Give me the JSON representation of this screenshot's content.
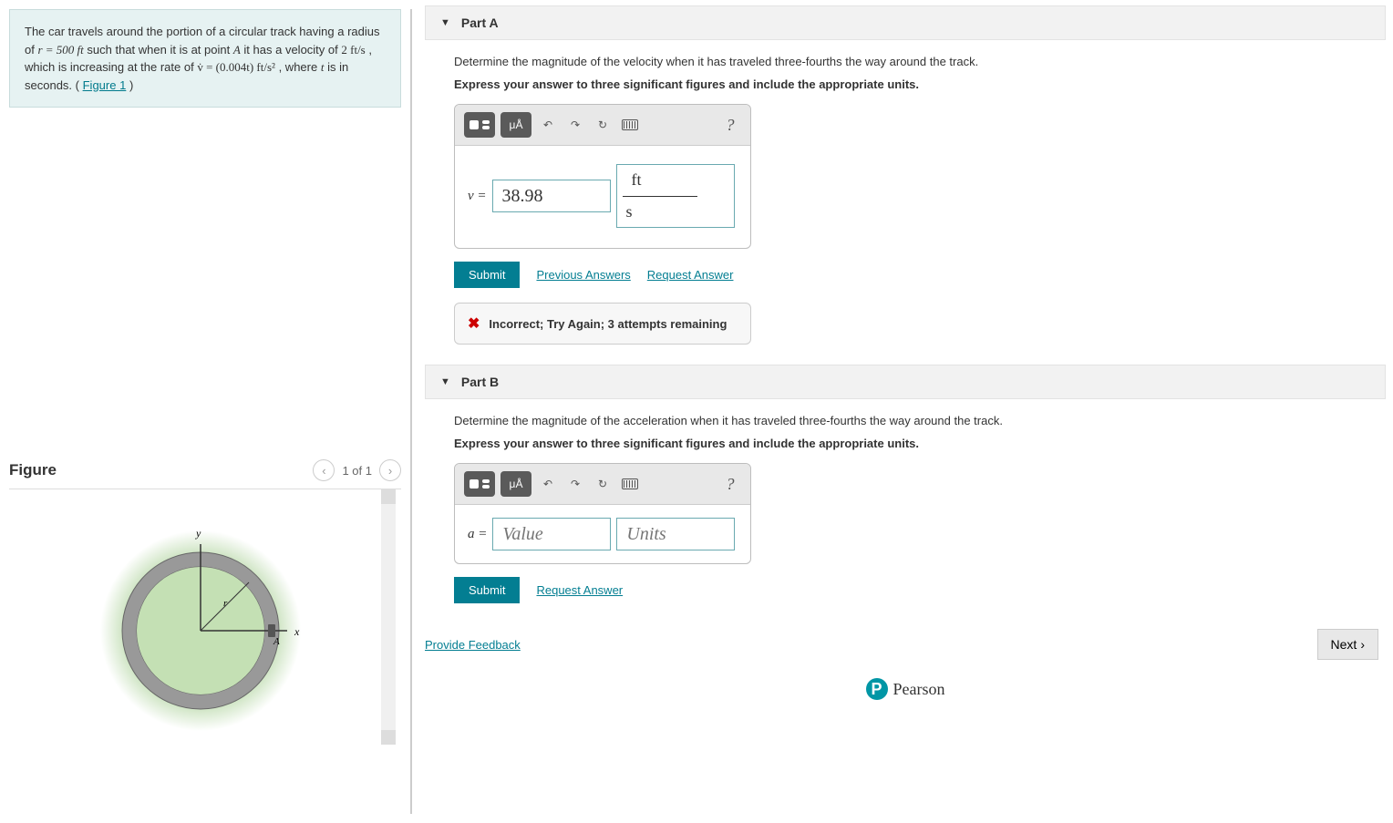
{
  "problem": {
    "text_pre": "The car travels around the portion of a circular track having a radius of ",
    "radius_expr": "r = 500 ft",
    "text_mid1": " such that when it is at point ",
    "point_label": "A",
    "text_mid2": " it has a velocity of ",
    "v0_expr": "2 ft/s",
    "text_mid3": " , which is increasing at the rate of ",
    "rate_expr": "v̇ = (0.004t) ft/s²",
    "text_mid4": ", where ",
    "t_label": "t",
    "text_end": " is in seconds. (",
    "figure_link": "Figure 1",
    "text_close": ")"
  },
  "figure": {
    "title": "Figure",
    "page_label": "1 of 1",
    "y_label": "y",
    "x_label": "x",
    "r_label": "r",
    "a_label": "A"
  },
  "partA": {
    "title": "Part A",
    "question": "Determine the magnitude of the velocity when it has traveled three-fourths the way around the track.",
    "instruction": "Express your answer to three significant figures and include the appropriate units.",
    "var_label": "v =",
    "value": "38.98",
    "unit_top": "ft",
    "unit_bot": "s",
    "submit": "Submit",
    "prev_answers": "Previous Answers",
    "request_answer": "Request Answer",
    "feedback": "Incorrect; Try Again; 3 attempts remaining"
  },
  "partB": {
    "title": "Part B",
    "question": "Determine the magnitude of the acceleration when it has traveled three-fourths the way around the track.",
    "instruction": "Express your answer to three significant figures and include the appropriate units.",
    "var_label": "a =",
    "value_placeholder": "Value",
    "units_placeholder": "Units",
    "submit": "Submit",
    "request_answer": "Request Answer"
  },
  "footer": {
    "feedback_link": "Provide Feedback",
    "next": "Next",
    "brand": "Pearson"
  },
  "toolbar": {
    "special": "μÅ",
    "help": "?"
  }
}
